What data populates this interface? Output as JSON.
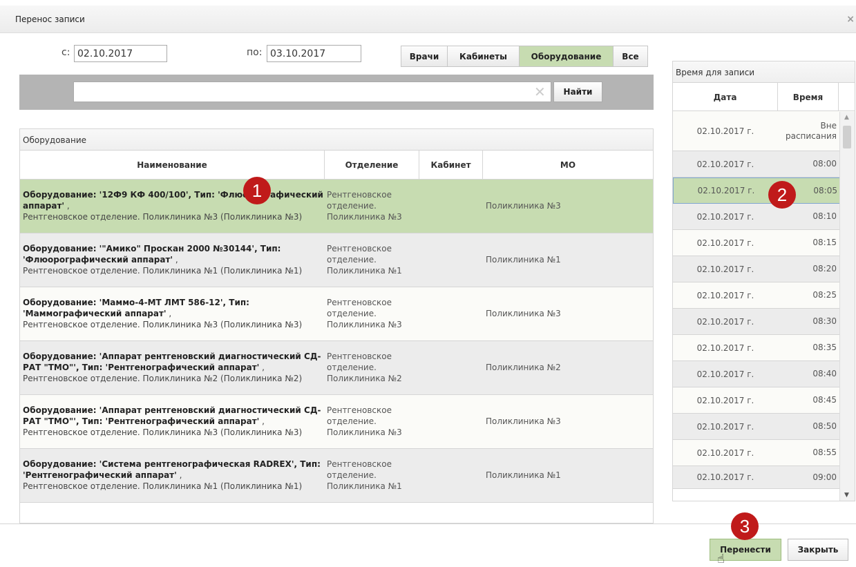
{
  "dialog": {
    "title": "Перенос записи",
    "close_glyph": "×"
  },
  "filters": {
    "from_label": "с:",
    "from_value": "02.10.2017",
    "to_label": "по:",
    "to_value": "03.10.2017",
    "tabs": [
      {
        "label": "Врачи",
        "active": false
      },
      {
        "label": "Кабинеты",
        "active": false
      },
      {
        "label": "Оборудование",
        "active": true
      },
      {
        "label": "Все",
        "active": false
      }
    ]
  },
  "search": {
    "value": "",
    "clear_glyph": "✕",
    "find_label": "Найти"
  },
  "equipment": {
    "panel_title": "Оборудование",
    "columns": [
      "Наименование",
      "Отделение",
      "Кабинет",
      "МО"
    ],
    "rows": [
      {
        "bold": "Оборудование: '12Ф9 КФ 400/100', Тип: 'Флюорографический аппарат'",
        "sub": "Рентгеновское отделение. Поликлиника №3 (Поликлиника №3)",
        "dept": "Рентгеновское отделение. Поликлиника №3",
        "cabinet": "",
        "mo": "Поликлиника №3",
        "selected": true
      },
      {
        "bold": "Оборудование: '\"Амико\" Проскан 2000 №30144', Тип: 'Флюорографический аппарат'",
        "sub": "Рентгеновское отделение. Поликлиника №1 (Поликлиника №1)",
        "dept": "Рентгеновское отделение. Поликлиника №1",
        "cabinet": "",
        "mo": "Поликлиника №1",
        "selected": false
      },
      {
        "bold": "Оборудование: 'Маммо-4-МТ ЛМТ 586-12', Тип: 'Маммографический аппарат'",
        "sub": "Рентгеновское отделение. Поликлиника №3 (Поликлиника №3)",
        "dept": "Рентгеновское отделение. Поликлиника №3",
        "cabinet": "",
        "mo": "Поликлиника №3",
        "selected": false
      },
      {
        "bold": "Оборудование: 'Аппарат рентгеновский диагностический СД-РАТ \"ТМО\"', Тип: 'Рентгенографический аппарат'",
        "sub": "Рентгеновское отделение. Поликлиника №2 (Поликлиника №2)",
        "dept": "Рентгеновское отделение. Поликлиника №2",
        "cabinet": "",
        "mo": "Поликлиника №2",
        "selected": false
      },
      {
        "bold": "Оборудование: 'Аппарат рентгеновский диагностический СД-РАТ \"ТМО\"', Тип: 'Рентгенографический аппарат'",
        "sub": "Рентгеновское отделение. Поликлиника №3 (Поликлиника №3)",
        "dept": "Рентгеновское отделение. Поликлиника №3",
        "cabinet": "",
        "mo": "Поликлиника №3",
        "selected": false
      },
      {
        "bold": "Оборудование: 'Система рентгенографическая RADREX', Тип: 'Рентгенографический аппарат'",
        "sub": "Рентгеновское отделение. Поликлиника №1 (Поликлиника №1)",
        "dept": "Рентгеновское отделение. Поликлиника №1",
        "cabinet": "",
        "mo": "Поликлиника №1",
        "selected": false
      }
    ]
  },
  "times": {
    "panel_title": "Время для записи",
    "columns": [
      "Дата",
      "Время"
    ],
    "rows": [
      {
        "date": "02.10.2017 г.",
        "time": "Вне расписания",
        "selected": false
      },
      {
        "date": "02.10.2017 г.",
        "time": "08:00",
        "selected": false
      },
      {
        "date": "02.10.2017 г.",
        "time": "08:05",
        "selected": true
      },
      {
        "date": "02.10.2017 г.",
        "time": "08:10",
        "selected": false
      },
      {
        "date": "02.10.2017 г.",
        "time": "08:15",
        "selected": false
      },
      {
        "date": "02.10.2017 г.",
        "time": "08:20",
        "selected": false
      },
      {
        "date": "02.10.2017 г.",
        "time": "08:25",
        "selected": false
      },
      {
        "date": "02.10.2017 г.",
        "time": "08:30",
        "selected": false
      },
      {
        "date": "02.10.2017 г.",
        "time": "08:35",
        "selected": false
      },
      {
        "date": "02.10.2017 г.",
        "time": "08:40",
        "selected": false
      },
      {
        "date": "02.10.2017 г.",
        "time": "08:45",
        "selected": false
      },
      {
        "date": "02.10.2017 г.",
        "time": "08:50",
        "selected": false
      },
      {
        "date": "02.10.2017 г.",
        "time": "08:55",
        "selected": false
      },
      {
        "date": "02.10.2017 г.",
        "time": "09:00",
        "selected": false
      }
    ]
  },
  "footer": {
    "move_label": "Перенести",
    "close_label": "Закрыть"
  },
  "badges": [
    "1",
    "2",
    "3"
  ],
  "colors": {
    "selected_row": "#c7dcb1",
    "badge": "#c01a1a"
  }
}
